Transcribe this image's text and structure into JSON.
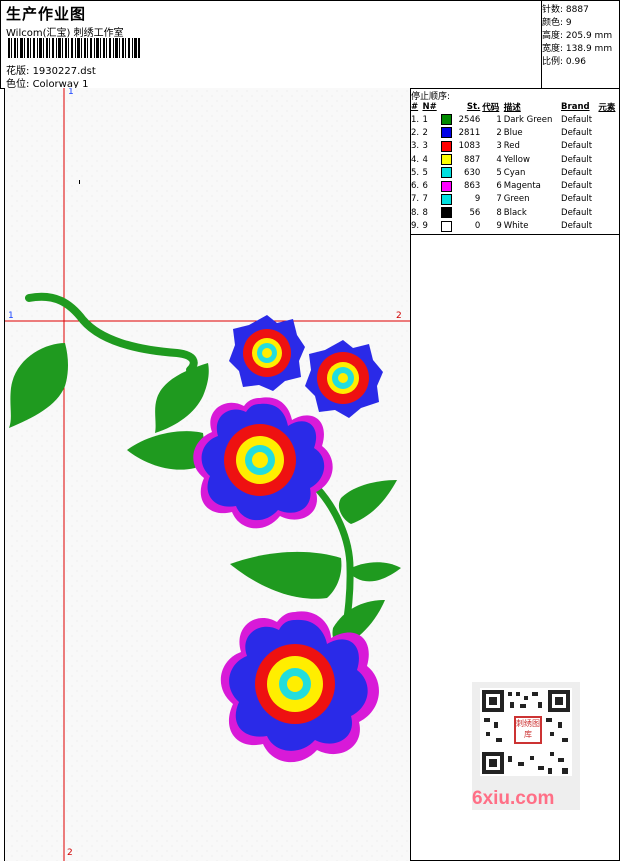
{
  "header": {
    "title": "生产作业图",
    "studio": "Wilcom(汇宝) 刺绣工作室",
    "design_label": "花版:",
    "design_file": "1930227.dst",
    "colorway_label": "色位:",
    "colorway": "Colorway 1"
  },
  "stats": [
    {
      "label": "针数:",
      "value": "8887"
    },
    {
      "label": "颜色:",
      "value": "9"
    },
    {
      "label": "高度:",
      "value": "205.9 mm"
    },
    {
      "label": "宽度:",
      "value": "138.9 mm"
    },
    {
      "label": "比例:",
      "value": "0.96"
    }
  ],
  "stop_sequence": {
    "title": "停止顺序:",
    "headers": [
      "#",
      "N#",
      "St.",
      "代码",
      "描述",
      "Brand",
      "元素"
    ],
    "rows": [
      {
        "n": "1.",
        "nn": "1",
        "color": "#008a00",
        "st": "2546",
        "code": "1",
        "desc": "Dark Green",
        "brand": "Default"
      },
      {
        "n": "2.",
        "nn": "2",
        "color": "#0000e6",
        "st": "2811",
        "code": "2",
        "desc": "Blue",
        "brand": "Default"
      },
      {
        "n": "3.",
        "nn": "3",
        "color": "#ff0000",
        "st": "1083",
        "code": "3",
        "desc": "Red",
        "brand": "Default"
      },
      {
        "n": "4.",
        "nn": "4",
        "color": "#ffff00",
        "st": "887",
        "code": "4",
        "desc": "Yellow",
        "brand": "Default"
      },
      {
        "n": "5.",
        "nn": "5",
        "color": "#00e0e0",
        "st": "630",
        "code": "5",
        "desc": "Cyan",
        "brand": "Default"
      },
      {
        "n": "6.",
        "nn": "6",
        "color": "#ff00ff",
        "st": "863",
        "code": "6",
        "desc": "Magenta",
        "brand": "Default"
      },
      {
        "n": "7.",
        "nn": "7",
        "color": "#00e0e0",
        "st": "9",
        "code": "7",
        "desc": "Green",
        "brand": "Default"
      },
      {
        "n": "8.",
        "nn": "8",
        "color": "#000000",
        "st": "56",
        "code": "8",
        "desc": "Black",
        "brand": "Default"
      },
      {
        "n": "9.",
        "nn": "9",
        "color": "#ffffff",
        "st": "0",
        "code": "9",
        "desc": "White",
        "brand": "Default"
      }
    ]
  },
  "canvas": {
    "guide_labels": {
      "top": "1",
      "left": "1",
      "right": "2",
      "bottom": "2"
    }
  },
  "watermark": {
    "seal_text": "刺绣图库",
    "site": "6xiu.com"
  },
  "colors": {
    "leaf": "#1f9a1f",
    "petal_outer": "#2a2ae8",
    "petal_red": "#ee1111",
    "petal_yellow": "#ffee00",
    "center": "#22dddd",
    "edge": "#d81ad8",
    "guide": "#e00000"
  }
}
